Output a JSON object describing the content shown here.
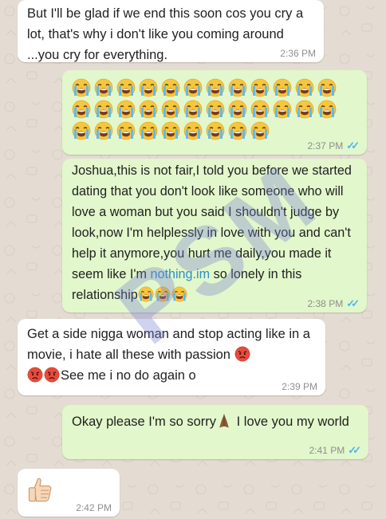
{
  "messages": [
    {
      "id": "m1",
      "direction": "in",
      "text": "But I'll be glad if we end this soon cos you cry a lot, that's why i don't like you coming around ...you cry for everything.",
      "time": "2:36 PM"
    },
    {
      "id": "m2",
      "direction": "out",
      "emoji": "loudly-crying-face",
      "emoji_count": 33,
      "time": "2:37 PM"
    },
    {
      "id": "m3",
      "direction": "out",
      "text_a": "Joshua,this is not fair,I told you before we started dating that you don't look like someone who will love a woman but you said I shouldn't judge by look,now I'm helplessly in love with you and can't help it anymore,you hurt me daily,you made it seem like I'm ",
      "link": "nothing.im",
      "text_b": " so lonely in this relationship",
      "emoji": "loudly-crying-face",
      "emoji_count": 3,
      "time": "2:38 PM"
    },
    {
      "id": "m4",
      "direction": "in",
      "text_a": "Get a side nigga woman and stop acting like in a movie, i hate all these with passion ",
      "emoji": "angry-face",
      "text_b": "See me i no do again o",
      "time": "2:39 PM"
    },
    {
      "id": "m5",
      "direction": "out",
      "text_a": "Okay please I'm so sorry",
      "emoji": "folded-hands",
      "text_b": " I love you my world",
      "time": "2:41 PM"
    },
    {
      "id": "m6",
      "direction": "in",
      "emoji": "thumbs-up",
      "time": "2:42 PM"
    }
  ],
  "watermark": "PSM",
  "colors": {
    "incoming": "#ffffff",
    "outgoing": "#e2f7cb",
    "read_ticks": "#4fb6ec",
    "link": "#2e8ec9"
  }
}
